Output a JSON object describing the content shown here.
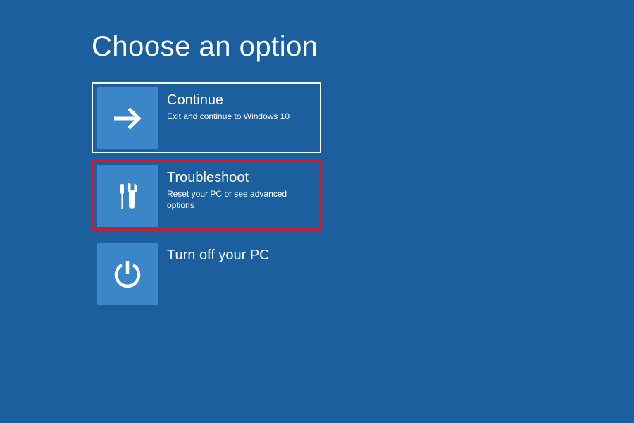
{
  "title": "Choose an option",
  "options": [
    {
      "id": "continue",
      "title": "Continue",
      "desc": "Exit and continue to Windows 10",
      "icon": "arrow-right",
      "selected": true,
      "highlighted": false
    },
    {
      "id": "troubleshoot",
      "title": "Troubleshoot",
      "desc": "Reset your PC or see advanced options",
      "icon": "tools",
      "selected": false,
      "highlighted": true
    },
    {
      "id": "turn-off",
      "title": "Turn off your PC",
      "desc": "",
      "icon": "power",
      "selected": false,
      "highlighted": false
    }
  ]
}
